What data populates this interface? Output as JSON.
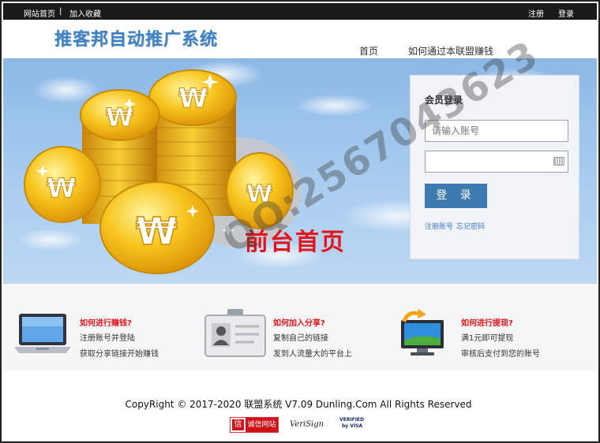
{
  "topbar": {
    "home_link": "网站首页",
    "separator": "|",
    "bookmark_link": "加入收藏",
    "register_link": "注册",
    "login_link": "登录"
  },
  "header": {
    "logo": "推客邦自动推广系统",
    "nav_home": "首页",
    "nav_earn": "如何通过本联盟赚钱"
  },
  "banner": {
    "title": "前台首页"
  },
  "login": {
    "title": "会员登录",
    "account_placeholder": "请输入账号",
    "password_placeholder": "",
    "submit": "登 录",
    "register": "注册账号",
    "forgot": "忘记密码"
  },
  "features": [
    {
      "heading": "如何进行赚钱?",
      "line1": "注册账号并登陆",
      "line2": "获取分享链接开始赚钱",
      "icon": "laptop-icon"
    },
    {
      "heading": "如何加入分享?",
      "line1": "复制自己的链接",
      "line2": "发到人流量大的平台上",
      "icon": "id-card-icon"
    },
    {
      "heading": "如何进行提现?",
      "line1": "满1元即可提现",
      "line2": "审核后支付到您的账号",
      "icon": "monitor-refresh-icon"
    }
  ],
  "footer": {
    "copyright": "CopyRight © 2017-2020 联盟系统 V7.09 Dunling.Com All Rights Reserved",
    "badge1_glyph": "信",
    "badge1": "诚信网站",
    "badge2": "VeriSign",
    "badge3_line1": "VERIFIED",
    "badge3_line2": "by VISA"
  },
  "watermark": "QQ:2567043623",
  "colors": {
    "accent_red": "#e4141c",
    "button_blue": "#3d7ab0",
    "logo_blue": "#3b82c4",
    "topbar": "#1a1a1a"
  }
}
